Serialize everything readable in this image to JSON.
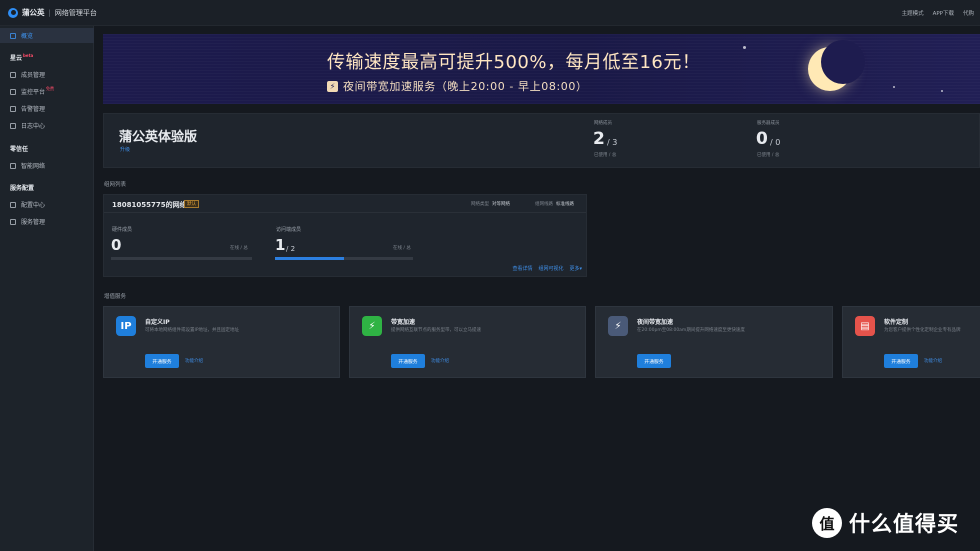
{
  "header": {
    "brand": "蒲公英",
    "separator": "|",
    "subtitle": "网络管理平台",
    "links": [
      "主题模式",
      "APP下载",
      "代购"
    ]
  },
  "sidebar": {
    "overview": "概览",
    "group_xingyun": "星云",
    "group_xingyun_tag": "beta",
    "items_xingyun": [
      "成员管理",
      "监控平台",
      "告警管理",
      "日志中心"
    ],
    "monitor_tag": "免费",
    "group_zero_trust": "零信任",
    "items_zero_trust": [
      "智能网络"
    ],
    "group_service": "服务配置",
    "items_service": [
      "配置中心",
      "服务管理"
    ]
  },
  "banner": {
    "headline": "传输速度最高可提升500%，每月低至16元！",
    "sub": "夜间带宽加速服务（晚上20:00 - 早上08:00）",
    "bolt": "⚡"
  },
  "account": {
    "title": "蒲公英体验版",
    "upgrade_link": "升级",
    "stat1": {
      "label": "网络成员",
      "num": "2",
      "den": "/ 3",
      "foot": "已使用 / 总"
    },
    "stat2": {
      "label": "服务器成员",
      "num": "0",
      "den": "/ 0",
      "foot": "已使用 / 总"
    }
  },
  "network_section": {
    "title": "组网列表",
    "name": "18081055775的网络",
    "badge": "默认",
    "type_label": "网络类型",
    "type_value": "对等网络",
    "route_label": "组网线路",
    "route_value": "标准线路",
    "hardware": {
      "label": "硬件成员",
      "num": "0",
      "right": "在线 / 总",
      "progress": 0
    },
    "access": {
      "label": "访问端成员",
      "num": "1",
      "den": "/ 2",
      "right": "在线 / 总",
      "progress": 0.5
    },
    "actions": [
      "查看详情",
      "组网可视化",
      "更多▾"
    ]
  },
  "services_section": {
    "title": "增值服务",
    "cards": [
      {
        "title": "自定义IP",
        "desc": "可将本地网络组件或设置IP地址，并且固定地址",
        "button": "开通服务",
        "link": "功能介绍",
        "icon": "ip-icon",
        "icon_text": "IP",
        "color": "#1f7fdc"
      },
      {
        "title": "带宽加速",
        "desc": "提供网络互联节点的服务型带，可以立马提速",
        "button": "开通服务",
        "link": "功能介绍",
        "icon": "lightning-icon",
        "icon_text": "⚡",
        "color": "#2fb344"
      },
      {
        "title": "夜间带宽加速",
        "desc": "在20:00pm至08:00am期间提升网络速度至更快速度",
        "button": "开通服务",
        "link": "",
        "icon": "night-lightning-icon",
        "icon_text": "⚡",
        "color": "#4a5a78"
      },
      {
        "title": "软件定制",
        "desc": "为您客户提供个性化定制企业专有品牌",
        "button": "开通服务",
        "link": "功能介绍",
        "icon": "app-window-icon",
        "icon_text": "▤",
        "color": "#e5534b"
      }
    ]
  },
  "watermark": {
    "logo": "值",
    "text": "什么值得买"
  }
}
